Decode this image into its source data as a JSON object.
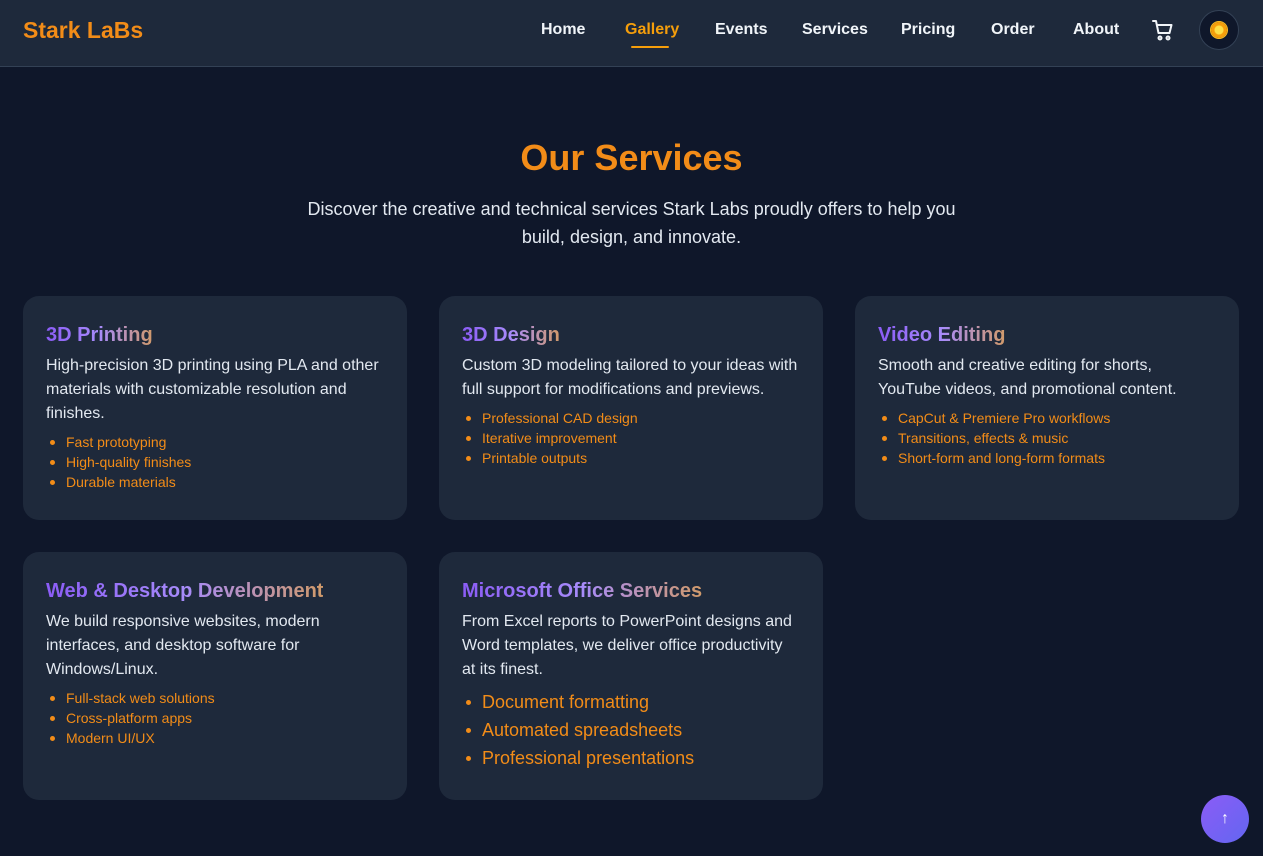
{
  "brand": "Stark LaBs",
  "nav": {
    "links": [
      "Home",
      "Gallery",
      "Events",
      "Services",
      "Pricing",
      "Order",
      "About"
    ],
    "active": "Gallery"
  },
  "page": {
    "title": "Our Services",
    "subtitle": "Discover the creative and technical services Stark Labs proudly offers to help you build, design, and innovate."
  },
  "services": [
    {
      "title": "3D Printing",
      "description": "High-precision 3D printing using PLA and other materials with customizable resolution and finishes.",
      "features": [
        "Fast prototyping",
        "High-quality finishes",
        "Durable materials"
      ]
    },
    {
      "title": "3D Design",
      "description": "Custom 3D modeling tailored to your ideas with full support for modifications and previews.",
      "features": [
        "Professional CAD design",
        "Iterative improvement",
        "Printable outputs"
      ]
    },
    {
      "title": "Video Editing",
      "description": "Smooth and creative editing for shorts, YouTube videos, and promotional content.",
      "features": [
        "CapCut & Premiere Pro workflows",
        "Transitions, effects & music",
        "Short-form and long-form formats"
      ]
    },
    {
      "title": "Web & Desktop Development",
      "description": "We build responsive websites, modern interfaces, and desktop software for Windows/Linux.",
      "features": [
        "Full-stack web solutions",
        "Cross-platform apps",
        "Modern UI/UX"
      ]
    },
    {
      "title": "Microsoft Office Services",
      "description": "From Excel reports to PowerPoint designs and Word templates, we deliver office productivity at its finest.",
      "features": [
        "Document formatting",
        "Automated spreadsheets",
        "Professional presentations"
      ]
    }
  ],
  "scroll_top": "↑",
  "icons": {
    "cart": "cart-icon",
    "theme": "sun-icon",
    "scroll": "arrow-up-icon"
  },
  "colors": {
    "accent": "#f28c18",
    "background": "#0f172a",
    "card": "#1e293b",
    "title_gradient_start": "#8b5cf6"
  }
}
